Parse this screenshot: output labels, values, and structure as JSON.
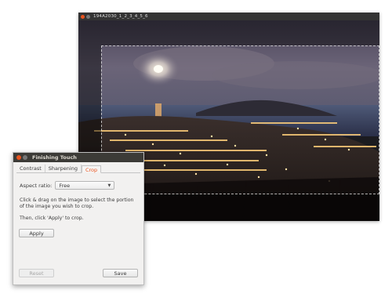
{
  "image_window": {
    "title": "194A2030_1_2_3_4_5_6"
  },
  "dialog": {
    "title": "Finishing Touch",
    "tabs": [
      "Contrast",
      "Sharpening",
      "Crop"
    ],
    "active_tab": "Crop",
    "aspect_label": "Aspect ratio:",
    "aspect_value": "Free",
    "instruction": "Click & drag on the image to select the portion of the image you wish to crop.",
    "then_text": "Then, click 'Apply' to crop.",
    "apply_label": "Apply",
    "reset_label": "Reset",
    "save_label": "Save"
  },
  "colors": {
    "accent": "#e95420",
    "titlebar_dark": "#3c3b37"
  }
}
